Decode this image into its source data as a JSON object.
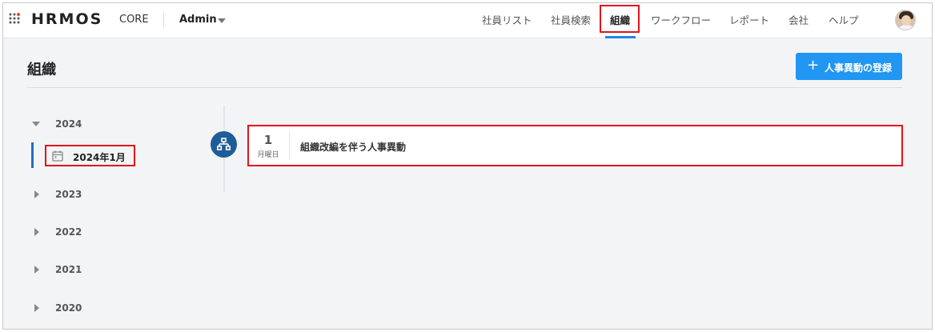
{
  "header": {
    "logo": "HRMOS",
    "logo_sub": "CORE",
    "org_selector": "Admin",
    "nav": [
      {
        "label": "社員リスト"
      },
      {
        "label": "社員検索"
      },
      {
        "label": "組織"
      },
      {
        "label": "ワークフロー"
      },
      {
        "label": "レポート"
      },
      {
        "label": "会社"
      },
      {
        "label": "ヘルプ"
      }
    ],
    "active_nav": "組織"
  },
  "page": {
    "title": "組織",
    "add_button_label": "人事異動の登録",
    "add_button_icon": "plus-icon"
  },
  "sidebar": {
    "years": [
      "2024",
      "2023",
      "2022",
      "2021",
      "2020"
    ],
    "expanded_year": "2024",
    "selected_month": "2024年1月"
  },
  "timeline": {
    "events": [
      {
        "day": "1",
        "weekday": "月曜日",
        "title": "組織改編を伴う人事異動",
        "icon": "org-chart-icon"
      }
    ]
  },
  "colors": {
    "accent": "#2196f3",
    "highlight": "#e0141c",
    "timeline_icon": "#1f5c9a",
    "logo_dot": "#e94235"
  }
}
